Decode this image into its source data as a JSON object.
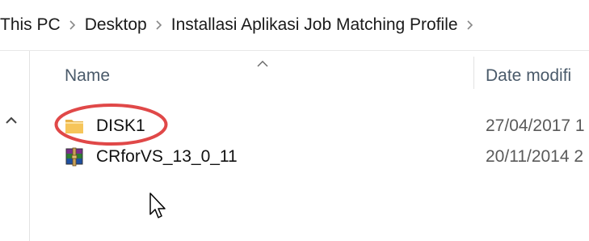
{
  "breadcrumb": [
    {
      "label": "This PC"
    },
    {
      "label": "Desktop"
    },
    {
      "label": "Installasi Aplikasi Job Matching Profile"
    }
  ],
  "columns": {
    "name": "Name",
    "date_modified": "Date modifi"
  },
  "files": [
    {
      "name": "DISK1",
      "date": "27/04/2017 1",
      "icon": "folder-icon",
      "highlighted": true
    },
    {
      "name": "CRforVS_13_0_11",
      "date": "20/11/2014 2",
      "icon": "winrar-archive-icon",
      "highlighted": false
    }
  ],
  "colors": {
    "highlight_ring": "#e04848",
    "folder": "#f6c55a",
    "header_text": "#4a5a6a"
  }
}
